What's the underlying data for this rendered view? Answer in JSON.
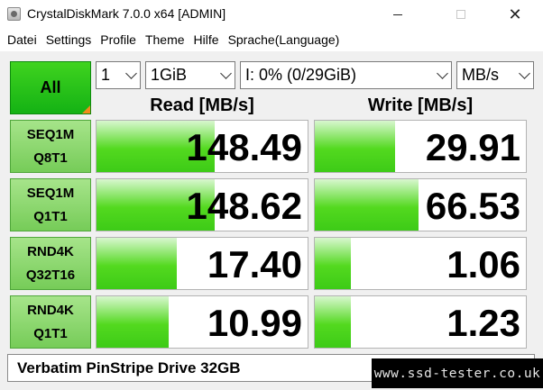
{
  "window": {
    "title": "CrystalDiskMark 7.0.0 x64 [ADMIN]",
    "buttons": {
      "minimize": "—",
      "maximize": "☐",
      "close": "✕"
    }
  },
  "menu": [
    "Datei",
    "Settings",
    "Profile",
    "Theme",
    "Hilfe",
    "Sprache(Language)"
  ],
  "controls": {
    "all_label": "All",
    "count": "1",
    "size": "1GiB",
    "drive": "I: 0% (0/29GiB)",
    "unit": "MB/s"
  },
  "headers": {
    "read": "Read [MB/s]",
    "write": "Write [MB/s]"
  },
  "tests": [
    {
      "line1": "SEQ1M",
      "line2": "Q8T1",
      "read": "148.49",
      "write": "29.91",
      "read_fill_pct": 56,
      "write_fill_pct": 38
    },
    {
      "line1": "SEQ1M",
      "line2": "Q1T1",
      "read": "148.62",
      "write": "66.53",
      "read_fill_pct": 56,
      "write_fill_pct": 49
    },
    {
      "line1": "RND4K",
      "line2": "Q32T16",
      "read": "17.40",
      "write": "1.06",
      "read_fill_pct": 38,
      "write_fill_pct": 17
    },
    {
      "line1": "RND4K",
      "line2": "Q1T1",
      "read": "10.99",
      "write": "1.23",
      "read_fill_pct": 34,
      "write_fill_pct": 17
    }
  ],
  "comment": "Verbatim PinStripe Drive 32GB",
  "watermark": "www.ssd-tester.co.uk",
  "colors": {
    "accent_green": "#14b214",
    "test_button_green": "#76cc58",
    "bar_green": "#3dcb17",
    "corner_orange": "#f28a1a"
  }
}
